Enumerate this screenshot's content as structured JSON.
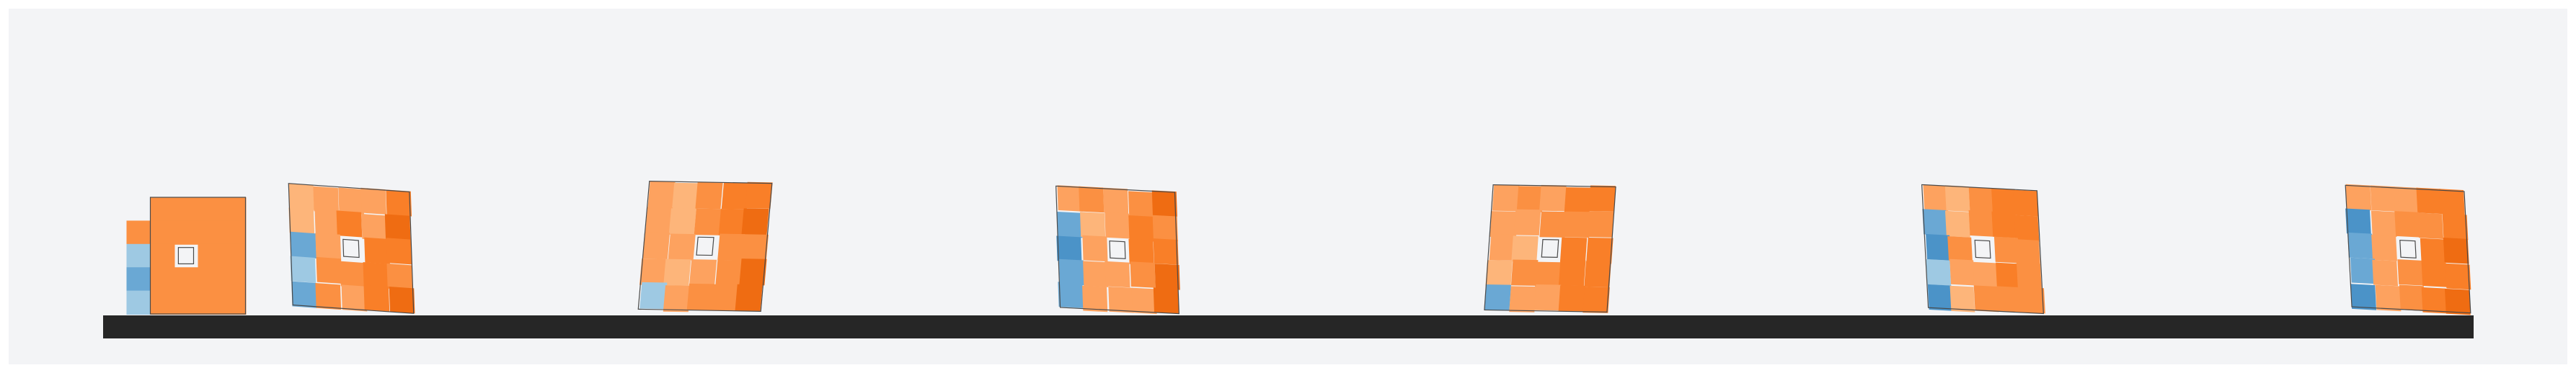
{
  "scene": {
    "description_visible_text": "",
    "colors": {
      "page_background": "#ffffff",
      "canvas_background": "#f3f4f6",
      "ground": "#262626",
      "outline": "#4a4a4a",
      "hole": "#f3f4f6",
      "orange_palette": [
        "#fdb57a",
        "#fda25f",
        "#fb9042",
        "#f97f28",
        "#ef6c12"
      ],
      "blue_palette": [
        "#9ec9e3",
        "#6aa8d4",
        "#4b93c8"
      ]
    },
    "frames": [
      {
        "id": "frame-1",
        "kind": "initial",
        "blue_level": 0.65
      },
      {
        "id": "frame-2",
        "kind": "deformed",
        "blue_level": 0.55
      },
      {
        "id": "frame-3",
        "kind": "deformed",
        "blue_level": 0.2
      },
      {
        "id": "frame-4",
        "kind": "deformed",
        "blue_level": 0.85
      },
      {
        "id": "frame-5",
        "kind": "deformed",
        "blue_level": 0.25
      },
      {
        "id": "frame-6",
        "kind": "deformed",
        "blue_level": 0.8
      },
      {
        "id": "frame-7",
        "kind": "deformed",
        "blue_level": 0.8
      }
    ]
  }
}
